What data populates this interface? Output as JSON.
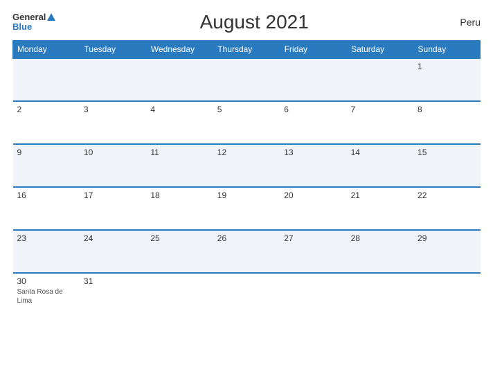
{
  "header": {
    "title": "August 2021",
    "country": "Peru",
    "logo_general": "General",
    "logo_blue": "Blue"
  },
  "weekdays": [
    "Monday",
    "Tuesday",
    "Wednesday",
    "Thursday",
    "Friday",
    "Saturday",
    "Sunday"
  ],
  "rows": [
    {
      "cells": [
        {
          "day": "",
          "event": ""
        },
        {
          "day": "",
          "event": ""
        },
        {
          "day": "",
          "event": ""
        },
        {
          "day": "",
          "event": ""
        },
        {
          "day": "",
          "event": ""
        },
        {
          "day": "",
          "event": ""
        },
        {
          "day": "1",
          "event": ""
        }
      ]
    },
    {
      "cells": [
        {
          "day": "2",
          "event": ""
        },
        {
          "day": "3",
          "event": ""
        },
        {
          "day": "4",
          "event": ""
        },
        {
          "day": "5",
          "event": ""
        },
        {
          "day": "6",
          "event": ""
        },
        {
          "day": "7",
          "event": ""
        },
        {
          "day": "8",
          "event": ""
        }
      ]
    },
    {
      "cells": [
        {
          "day": "9",
          "event": ""
        },
        {
          "day": "10",
          "event": ""
        },
        {
          "day": "11",
          "event": ""
        },
        {
          "day": "12",
          "event": ""
        },
        {
          "day": "13",
          "event": ""
        },
        {
          "day": "14",
          "event": ""
        },
        {
          "day": "15",
          "event": ""
        }
      ]
    },
    {
      "cells": [
        {
          "day": "16",
          "event": ""
        },
        {
          "day": "17",
          "event": ""
        },
        {
          "day": "18",
          "event": ""
        },
        {
          "day": "19",
          "event": ""
        },
        {
          "day": "20",
          "event": ""
        },
        {
          "day": "21",
          "event": ""
        },
        {
          "day": "22",
          "event": ""
        }
      ]
    },
    {
      "cells": [
        {
          "day": "23",
          "event": ""
        },
        {
          "day": "24",
          "event": ""
        },
        {
          "day": "25",
          "event": ""
        },
        {
          "day": "26",
          "event": ""
        },
        {
          "day": "27",
          "event": ""
        },
        {
          "day": "28",
          "event": ""
        },
        {
          "day": "29",
          "event": ""
        }
      ]
    },
    {
      "cells": [
        {
          "day": "30",
          "event": "Santa Rosa de Lima"
        },
        {
          "day": "31",
          "event": ""
        },
        {
          "day": "",
          "event": ""
        },
        {
          "day": "",
          "event": ""
        },
        {
          "day": "",
          "event": ""
        },
        {
          "day": "",
          "event": ""
        },
        {
          "day": "",
          "event": ""
        }
      ]
    }
  ]
}
